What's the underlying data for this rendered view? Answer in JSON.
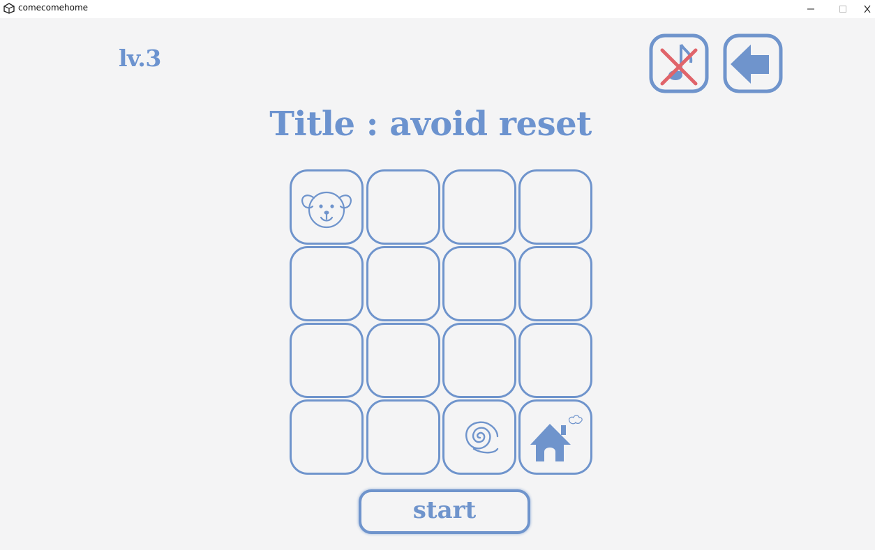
{
  "window": {
    "title": "comecomehome"
  },
  "hud": {
    "level": "lv.3",
    "title": "Title : avoid reset",
    "mute_icon": "music-muted-icon",
    "back_icon": "back-arrow-icon"
  },
  "board": {
    "rows": 4,
    "cols": 4,
    "cells": [
      [
        "puppy",
        "",
        "",
        ""
      ],
      [
        "",
        "",
        "",
        ""
      ],
      [
        "",
        "",
        "",
        ""
      ],
      [
        "",
        "",
        "spiral",
        "home"
      ]
    ]
  },
  "controls": {
    "start_label": "start"
  },
  "colors": {
    "accent": "#6f94cc",
    "mute_cross": "#e0646a",
    "background": "#f4f4f5"
  }
}
